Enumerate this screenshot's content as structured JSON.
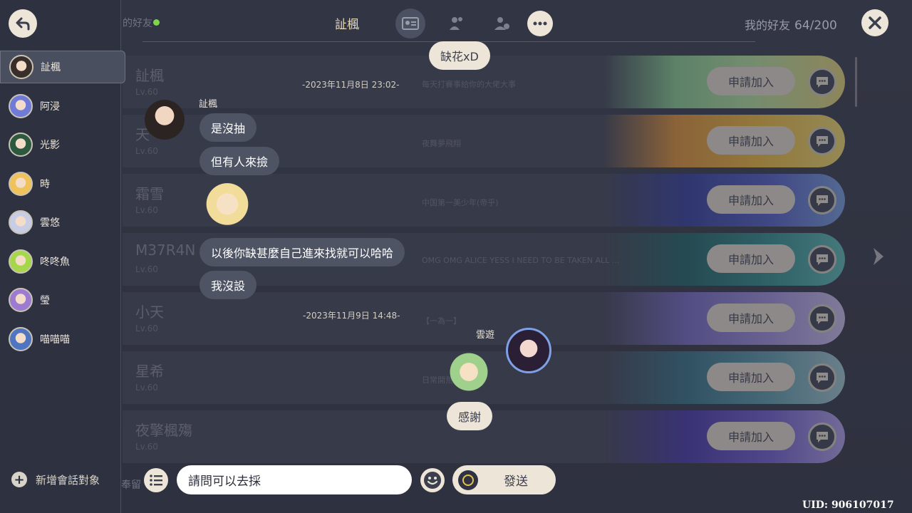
{
  "header": {
    "title": "訨楓",
    "online_hint": "的好友",
    "friends_label": "我的好友",
    "friends_count": "64/200"
  },
  "sidebar": {
    "contacts": [
      {
        "name": "訨楓",
        "color": "#3a2e2a"
      },
      {
        "name": "阿浸",
        "color": "#6f7bd6"
      },
      {
        "name": "光影",
        "color": "#2d5a3e"
      },
      {
        "name": "時",
        "color": "#f0c25a"
      },
      {
        "name": "雲悠",
        "color": "#c8cde6"
      },
      {
        "name": "咚咚魚",
        "color": "#a6d64a"
      },
      {
        "name": "瑩",
        "color": "#9d7bd0"
      },
      {
        "name": "喵喵喵",
        "color": "#4f74c0"
      }
    ],
    "add_label": "新增會話對象",
    "footer_hint": "奉留"
  },
  "friends_list": {
    "apply_label": "申請加入",
    "rows": [
      {
        "name": "訨楓",
        "level": "Lv.60",
        "signature": "每天打賽事給你的大佬大事",
        "art": "linear-gradient(90deg, rgba(120,200,130,0) 0%, #8fd39a 30%, #b8e6a8 60%, #e9d983 100%)"
      },
      {
        "name": "天",
        "level": "Lv.60",
        "signature": "夜舞夢飛翔",
        "art": "linear-gradient(90deg, rgba(230,170,70,0) 0%, #e49a45 30%, #f2c24a 65%, #f4e07a 100%)"
      },
      {
        "name": "霜雪",
        "level": "Lv.60",
        "signature": "中国第一美少年(帝乎)",
        "art": "linear-gradient(90deg, rgba(60,70,160,0) 0%, #3e4aa8 35%, #5c6bd0 70%, #7fa6e6 100%)"
      },
      {
        "name": "M37R4N",
        "level": "Lv.60",
        "signature": "OMG OMG ALICE YESS I NEED TO BE TAKEN ALL ...",
        "art": "linear-gradient(90deg, rgba(40,110,110,0) 0%, #2b6f73 35%, #3d9a9a 70%, #66c2bf 100%)"
      },
      {
        "name": "小天",
        "level": "Lv.60",
        "signature": "【一為一】",
        "art": "linear-gradient(90deg, rgba(120,110,200,0) 0%, #7d74cc 35%, #a79be6 70%, #cfc6f2 100%)"
      },
      {
        "name": "星希",
        "level": "Lv.60",
        "signature": "日常開荒",
        "art": "linear-gradient(90deg, rgba(60,120,140,0) 0%, #3f7c92 35%, #6ba6b8 70%, #a7cfd8 100%)"
      },
      {
        "name": "夜擎楓殤",
        "level": "Lv.60",
        "signature": "",
        "art": "linear-gradient(90deg, rgba(80,70,180,0) 0%, #4f43b3 35%, #7a6ad9 70%, #b7a9ef 100%)"
      }
    ]
  },
  "chat": {
    "top_bubble": "缺花xD",
    "timestamp1": "-2023年11月8日 23:02-",
    "sender1": "訨楓",
    "msg1": "是沒抽",
    "msg2": "但有人來撿",
    "msg3": "以後你缺甚麼自己進來找就可以哈哈",
    "msg4": "我沒設",
    "timestamp2": "-2023年11月9日 14:48-",
    "sender2": "雲遊",
    "msg5": "感謝"
  },
  "input": {
    "value": "請問可以去採",
    "send_label": "發送"
  },
  "uid": "UID: 906107017",
  "icons": [
    "back-icon",
    "profile-card-icon",
    "friends-icon",
    "add-friend-icon",
    "more-icon",
    "close-icon",
    "chat-icon",
    "list-icon",
    "emoji-icon",
    "plus-icon",
    "arrow-right-icon"
  ]
}
